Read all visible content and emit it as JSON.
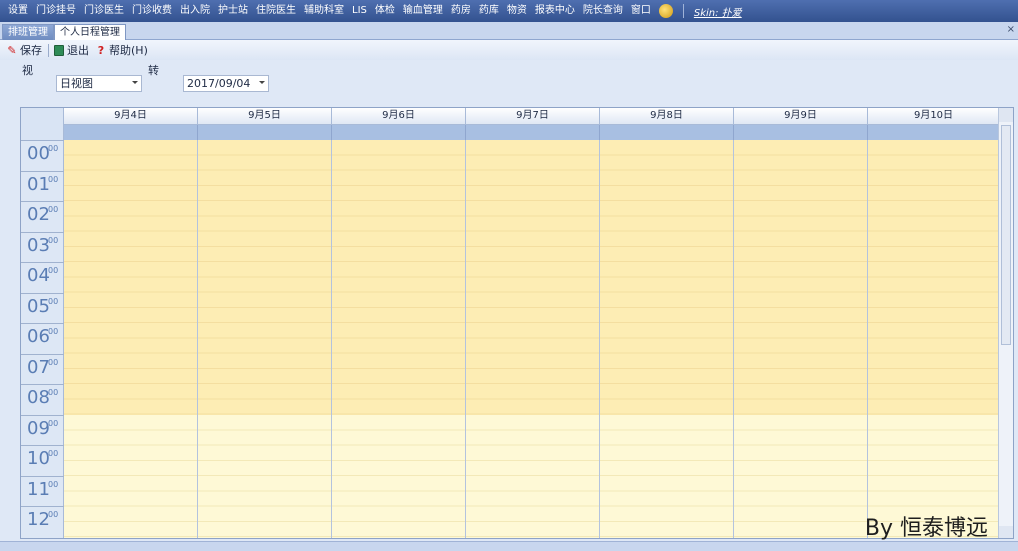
{
  "menu": {
    "items": [
      "设置",
      "门诊挂号",
      "门诊医生",
      "门诊收费",
      "出入院",
      "护士站",
      "住院医生",
      "辅助科室",
      "LIS",
      "体检",
      "输血管理",
      "药房",
      "药库",
      "物资",
      "报表中心",
      "院长查询",
      "窗口"
    ],
    "skin_label": "Skin: 扑爱"
  },
  "tabs": [
    {
      "label": "排班管理",
      "active": false
    },
    {
      "label": "个人日程管理",
      "active": true
    }
  ],
  "toolbar": {
    "save_label": "保存",
    "exit_label": "退出",
    "help_label": "帮助(H)"
  },
  "options": {
    "view_label": "视",
    "view_value": "日视图",
    "goto_label": "转",
    "date_value": "2017/09/04"
  },
  "scheduler": {
    "days": [
      "9月4日",
      "9月5日",
      "9月6日",
      "9月7日",
      "9月8日",
      "9月9日",
      "9月10日"
    ],
    "hours": [
      {
        "h": "00",
        "m": "00"
      },
      {
        "h": "01",
        "m": "00"
      },
      {
        "h": "02",
        "m": "00"
      },
      {
        "h": "03",
        "m": "00"
      },
      {
        "h": "04",
        "m": "00"
      },
      {
        "h": "05",
        "m": "00"
      },
      {
        "h": "06",
        "m": "00"
      },
      {
        "h": "07",
        "m": "00"
      },
      {
        "h": "08",
        "m": "00"
      },
      {
        "h": "09",
        "m": "00"
      },
      {
        "h": "10",
        "m": "00"
      },
      {
        "h": "11",
        "m": "00"
      },
      {
        "h": "12",
        "m": "00"
      }
    ]
  },
  "watermark": "By 恒泰博远",
  "colors": {
    "menubar": "#3f5f9f",
    "work_hours": "#fdedb4",
    "off_hours": "#fef9d6",
    "time_text": "#5a7db4"
  }
}
